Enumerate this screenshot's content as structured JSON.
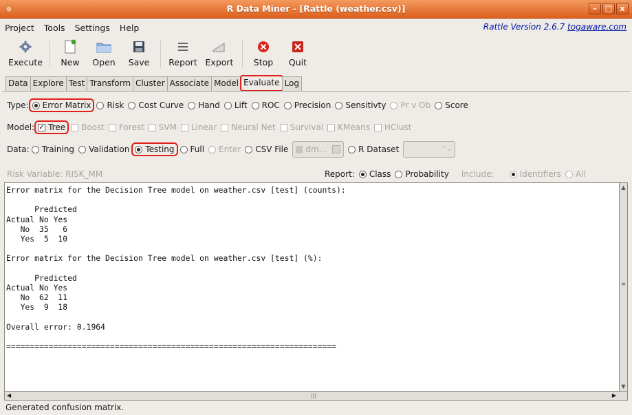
{
  "window": {
    "title": "R Data Miner - [Rattle (weather.csv)]",
    "min": "–",
    "max": "□",
    "close": "x"
  },
  "menu": {
    "items": [
      "Project",
      "Tools",
      "Settings",
      "Help"
    ],
    "version_text": "Rattle Version 2.6.7 ",
    "version_link": "togaware.com"
  },
  "toolbar": {
    "execute": "Execute",
    "new": "New",
    "open": "Open",
    "save": "Save",
    "report": "Report",
    "export": "Export",
    "stop": "Stop",
    "quit": "Quit"
  },
  "tabs": [
    "Data",
    "Explore",
    "Test",
    "Transform",
    "Cluster",
    "Associate",
    "Model",
    "Evaluate",
    "Log"
  ],
  "type_row": {
    "label": "Type:",
    "options": [
      "Error Matrix",
      "Risk",
      "Cost Curve",
      "Hand",
      "Lift",
      "ROC",
      "Precision",
      "Sensitivty",
      "Pr v Ob",
      "Score"
    ]
  },
  "model_row": {
    "label": "Model:",
    "options": [
      "Tree",
      "Boost",
      "Forest",
      "SVM",
      "Linear",
      "Neural Net",
      "Survival",
      "KMeans",
      "HClust"
    ]
  },
  "data_row": {
    "label": "Data:",
    "options": [
      "Training",
      "Validation",
      "Testing",
      "Full",
      "Enter",
      "CSV File"
    ],
    "file_value": "dm...",
    "rdataset": "R Dataset"
  },
  "risk_row": {
    "risk_label": "Risk Variable: RISK_MM",
    "report_label": "Report:",
    "class": "Class",
    "probability": "Probability",
    "include_label": "Include:",
    "identifiers": "Identifiers",
    "all": "All"
  },
  "output": {
    "text": "Error matrix for the Decision Tree model on weather.csv [test] (counts):\n\n      Predicted\nActual No Yes\n   No  35   6\n   Yes  5  10\n\nError matrix for the Decision Tree model on weather.csv [test] (%):\n\n      Predicted\nActual No Yes\n   No  62  11\n   Yes  9  18\n\nOverall error: 0.1964\n\n======================================================================"
  },
  "status": "Generated confusion matrix."
}
